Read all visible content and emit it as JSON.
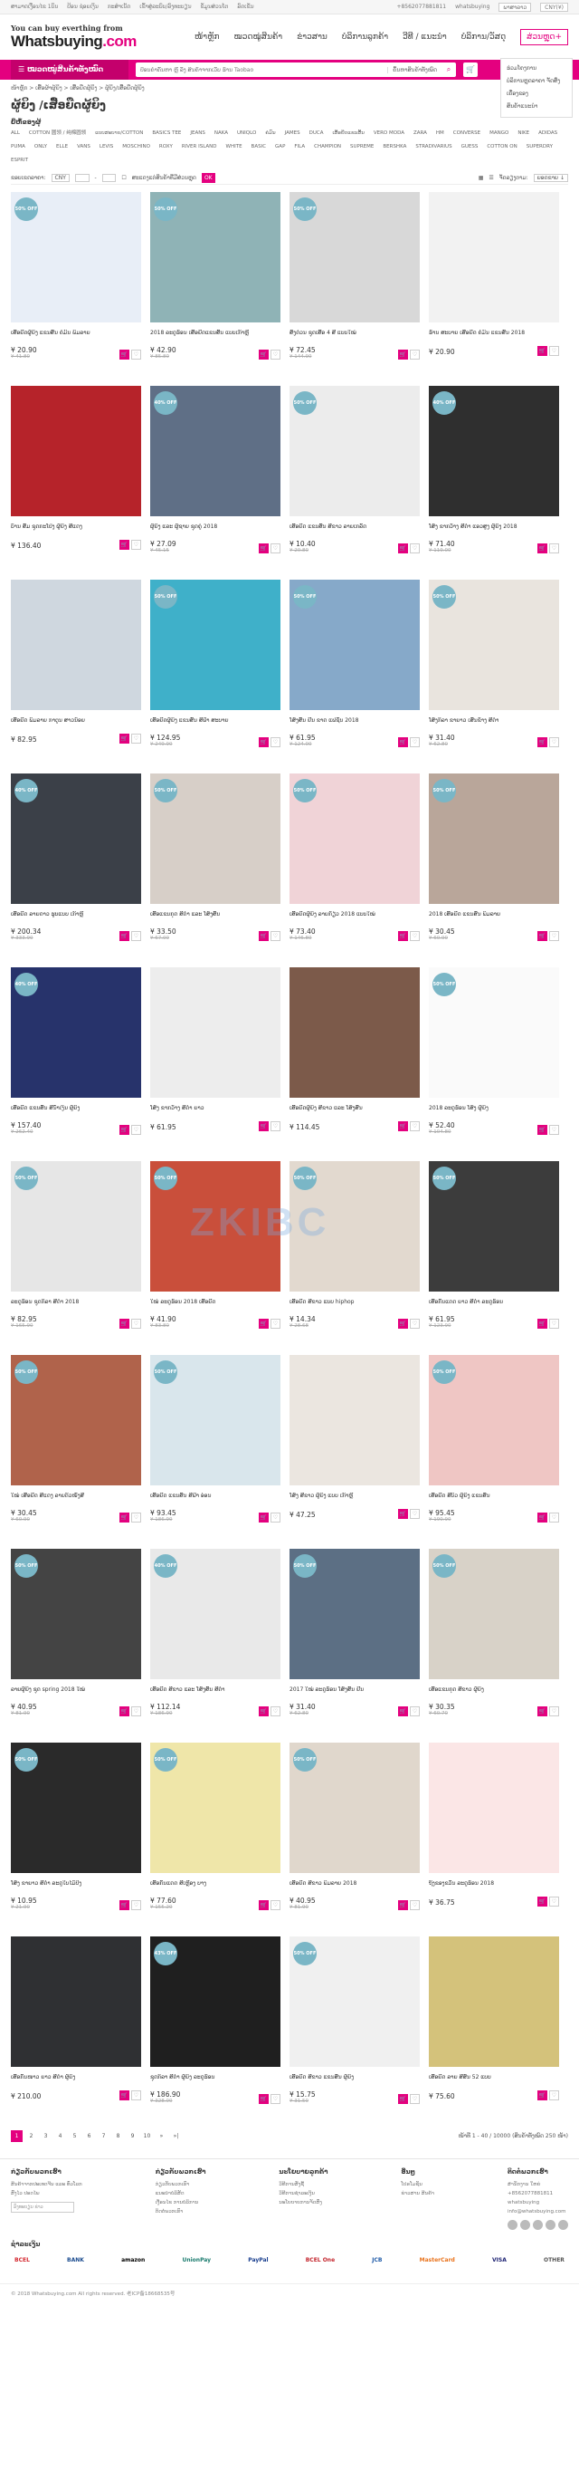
{
  "topbar": {
    "left": [
      "ສາມາດເງື່ອນໄຂ 1ບິນ",
      "ປ້ອນ ຊ່ອຍເງິນ",
      "ກະສຳເນັດ",
      "ເຂົ້າສູ່ລະບົບ/ລົງທະບຽນ",
      "ຂໍ້ມູນສ່ວນໂຕ",
      "ລົດເຂັນ"
    ],
    "phone": "+8562077881811",
    "wechat": "whatsbuying",
    "lang": "ພາສາລາວ",
    "currency": "CNY(¥)"
  },
  "header": {
    "tagline": "You can buy everthing from",
    "brand": "Whatsbuying",
    "brand_sub": ".com",
    "nav": [
      "ໜ້າຫຼັກ",
      "ໝວດໝູ່ສິນຄ້າ",
      "ຂ່າວສານ",
      "ບໍລິການລູກຄ້າ",
      "ວີທີ / ແນະນຳ",
      "ບໍລິການ/ວັສດຸ",
      "ສ່ວນຫຼຸດ+"
    ]
  },
  "catbar": {
    "label": "ໝວດໝູ່ສິນຄ້າທັງໝົດ",
    "search_placeholder": "ປ້ອນຄໍາຄົ້ນຫາ ຫຼື ລິ້ງ ສິນຄ້າຈາກເວັບ ຮ້ານ Taobao",
    "scope": "ຄົ້ນຫາສິນຄ້າທັງໝົດ"
  },
  "dropdown": [
    "ຮ່ວມໂຄງການ",
    "ບໍລິການຫຼຸດລາຄາ ຈັດສົ່ງເຄື່ອງຂອງ",
    "ສິນຄ້າແນະນໍາ"
  ],
  "breadcrumb": "ໜ້າຫຼັກ > ເສື້ອຜ້າຜູ້ຍິງ > ເສື້ອຍືດຜູ້ຍິງ > ຜູ້ຍິງ/ເສື້ອຍືດຜູ້ຍິງ",
  "title": "ຜູ້ຍິງ /ເສື້ອຍືດຜູ້ຍິງ",
  "filter_label": "ຍີ່ຫໍ້ຂອງຜູ້",
  "filters": [
    "ALL",
    "COTTON 圆领 / 纯棉圆领",
    "ແບບສະບາຍ/COTTON",
    "BASICS TEE",
    "JEANS",
    "NAKA",
    "UNIQLO",
    "ຄໍມົນ",
    "JAMES",
    "DUCA",
    "ເສື້ອຍືດແຂນສັ້ນ",
    "VERO MODA",
    "ZARA",
    "HM",
    "CONVERSE",
    "MANGO",
    "NIKE",
    "ADIDAS",
    "PUMA",
    "ONLY",
    "ELLE",
    "VANS",
    "LEVIS",
    "MOSCHINO",
    "ROXY",
    "RIVER ISLAND",
    "WHITE",
    "BASIC",
    "GAP",
    "FILA",
    "CHAMPION",
    "SUPREME",
    "BERSHKA",
    "STRADIVARIUS",
    "GUESS",
    "COTTON ON",
    "SUPERDRY",
    "ESPRIT"
  ],
  "sort": {
    "label": "ຂອບເຂດລາຄາ:",
    "currency": "CNY",
    "to": "-",
    "checkbox": "ສະແດງແຕ່ສິນຄ້າທີ່ມີສ່ວນຫຼຸດ",
    "go": "OK",
    "view": "ຈັດລຽງຕາມ:",
    "sort_sel": "ຍອດຂາຍ ↓"
  },
  "products": [
    {
      "t": "ເສື້ອຍືດຜູ້ຍິງ ແຂນສັ້ນ ຄໍມົນ ພິມລາຍ",
      "p": "¥ 20.90",
      "o": "¥ 41.80",
      "badge": "50% OFF",
      "c": "#e8eef7"
    },
    {
      "t": "2018 ລະດູຮ້ອນ ເສື້ອຍືດແຂນສັ້ນ ແບບເກົາຫຼີ",
      "p": "¥ 42.90",
      "o": "¥ 85.80",
      "badge": "50% OFF",
      "c": "#8fb3b6"
    },
    {
      "t": "ສົ່ງດ່ວນ ຊຸດເສື້ອ 4 ສີ ແບບໃໝ່",
      "p": "¥ 72.45",
      "o": "¥ 144.90",
      "badge": "50% OFF",
      "c": "#d8d8d8"
    },
    {
      "t": "ຮ້ານ ສະບາຍ ເສື້ອຍືດ ຄໍມົນ ແຂນສັ້ນ 2018",
      "p": "¥ 20.90",
      "o": "",
      "badge": "",
      "c": "#f2f2f2"
    },
    {
      "t": "ບ້ານ ສົ້ມ ຊຸດກະໂປ່ງ ຜູ້ຍິງ ສີແດງ",
      "p": "¥ 136.40",
      "o": "",
      "badge": "",
      "c": "#b6232a"
    },
    {
      "t": "ຜູ້ຍິງ ແລະ ຜູ້ຊາຍ ຊຸດຄູ່ 2018",
      "p": "¥ 27.09",
      "o": "¥ 45.15",
      "badge": "40% OFF",
      "c": "#5f6f86"
    },
    {
      "t": "ເສື້ອຍືດ ແຂນສັ້ນ ສີຂາວ ລາຍເກລັດ",
      "p": "¥ 10.40",
      "o": "¥ 20.80",
      "badge": "50% OFF",
      "c": "#ececec"
    },
    {
      "t": "ໂສ້ງ ຂາກວ້າງ ສີດຳ ແອວສູງ ຜູ້ຍິງ 2018",
      "p": "¥ 71.40",
      "o": "¥ 119.00",
      "badge": "40% OFF",
      "c": "#2f2f2f"
    },
    {
      "t": "ເສື້ອຍືດ ພິມລາຍ ກາຕູນ ສາວນ້ອຍ",
      "p": "¥ 82.95",
      "o": "",
      "badge": "",
      "c": "#cfd7df"
    },
    {
      "t": "ເສື້ອຍືດຜູ້ຍິງ ແຂນສັ້ນ ສີຟ້າ ສະບາຍ",
      "p": "¥ 124.95",
      "o": "¥ 249.90",
      "badge": "50% OFF",
      "c": "#3fb0c9"
    },
    {
      "t": "ໂສ້ງສັ້ນ ຢີນ ຂາດ ແຟຊັນ 2018",
      "p": "¥ 61.95",
      "o": "¥ 124.00",
      "badge": "50% OFF",
      "c": "#86a9c9"
    },
    {
      "t": "ໂສ້ງກິລາ ຂາຍາວ ເສັ້ນຂ້າງ ສີດຳ",
      "p": "¥ 31.40",
      "o": "¥ 62.80",
      "badge": "50% OFF",
      "c": "#e9e4de"
    },
    {
      "t": "ເສື້ອຍືດ ລາຍດາວ ຮູບແບບ ເກົາຫຼີ",
      "p": "¥ 200.34",
      "o": "¥ 333.90",
      "badge": "40% OFF",
      "c": "#3b4048"
    },
    {
      "t": "ເສື້ອແຂນກຸດ ສີດຳ ແລະ ໂສ້ງສັ້ນ",
      "p": "¥ 33.50",
      "o": "¥ 67.00",
      "badge": "50% OFF",
      "c": "#d7cfc8"
    },
    {
      "t": "ເສື້ອຍືດຜູ້ຍິງ ລາຍກ້ຽວ 2018 ແບບໃໝ່",
      "p": "¥ 73.40",
      "o": "¥ 146.80",
      "badge": "50% OFF",
      "c": "#f0d3d7"
    },
    {
      "t": "2018 ເສື້ອຍືດ ແຂນສັ້ນ ພິມລາຍ",
      "p": "¥ 30.45",
      "o": "¥ 60.90",
      "badge": "50% OFF",
      "c": "#b9a69a"
    },
    {
      "t": "ເສື້ອຍືດ ແຂນສັ້ນ ສີນ້ຳເງິນ ຜູ້ຍິງ",
      "p": "¥ 157.40",
      "o": "¥ 262.40",
      "badge": "40% OFF",
      "c": "#27336b"
    },
    {
      "t": "ໂສ້ງ ຂາກວ້າງ ສີດຳ ຍາວ",
      "p": "¥ 61.95",
      "o": "",
      "badge": "",
      "c": "#ededed"
    },
    {
      "t": "ເສື້ອຍືດຜູ້ຍິງ ສີຂາວ ແລະ ໂສ້ງສັ້ນ",
      "p": "¥ 114.45",
      "o": "",
      "badge": "",
      "c": "#7c5a4a"
    },
    {
      "t": "2018 ລະດູຮ້ອນ ໂສ້ງ ຜູ້ຍິງ",
      "p": "¥ 52.40",
      "o": "¥ 104.80",
      "badge": "50% OFF",
      "c": "#fafafa"
    },
    {
      "t": "ລະດູຮ້ອນ ຊຸດກິລາ ສີດຳ 2018",
      "p": "¥ 82.95",
      "o": "¥ 165.90",
      "badge": "50% OFF",
      "c": "#e6e6e6"
    },
    {
      "t": "ໃໝ່ ລະດູຮ້ອນ 2018 ເສື້ອຍືດ",
      "p": "¥ 41.90",
      "o": "¥ 83.80",
      "badge": "50% OFF",
      "c": "#c94f3b"
    },
    {
      "t": "ເສື້ອຍືດ ສີຂາວ ແບບ hiphop",
      "p": "¥ 14.34",
      "o": "¥ 28.68",
      "badge": "50% OFF",
      "c": "#e2d9cf"
    },
    {
      "t": "ເສື້ອກັນແດດ ຍາວ ສີດຳ ລະດູຮ້ອນ",
      "p": "¥ 61.95",
      "o": "¥ 123.90",
      "badge": "50% OFF",
      "c": "#3c3c3c"
    },
    {
      "t": "ໃໝ່ ເສື້ອຍືດ ສີແດງ ລາຍຕົວໜັງສື",
      "p": "¥ 30.45",
      "o": "¥ 60.90",
      "badge": "50% OFF",
      "c": "#b0634b"
    },
    {
      "t": "ເສື້ອຍືດ ແຂນສັ້ນ ສີຟ້າ ອ່ອນ",
      "p": "¥ 93.45",
      "o": "¥ 186.90",
      "badge": "50% OFF",
      "c": "#d9e6ec"
    },
    {
      "t": "ໂສ້ງ ສີຂາວ ຜູ້ຍິງ ແບບ ເກົາຫຼີ",
      "p": "¥ 47.25",
      "o": "",
      "badge": "",
      "c": "#ebe6e0"
    },
    {
      "t": "ເສື້ອຍືດ ສີບົວ ຜູ້ຍິງ ແຂນສັ້ນ",
      "p": "¥ 95.45",
      "o": "¥ 190.90",
      "badge": "50% OFF",
      "c": "#efc6c4"
    },
    {
      "t": "ລາຍຜູ້ຍິງ ຊຸດ spring 2018 ໃໝ່",
      "p": "¥ 40.95",
      "o": "¥ 81.90",
      "badge": "50% OFF",
      "c": "#444444"
    },
    {
      "t": "ເສື້ອຍືດ ສີຂາວ ແລະ ໂສ້ງສັ້ນ ສີດຳ",
      "p": "¥ 112.14",
      "o": "¥ 186.90",
      "badge": "40% OFF",
      "c": "#e9e9e9"
    },
    {
      "t": "2017 ໃໝ່ ລະດູຮ້ອນ ໂສ້ງສັ້ນ ຢີນ",
      "p": "¥ 31.40",
      "o": "¥ 62.80",
      "badge": "50% OFF",
      "c": "#5c6f84"
    },
    {
      "t": "ເສື້ອແຂນກຸດ ສີຂາວ ຜູ້ຍິງ",
      "p": "¥ 30.35",
      "o": "¥ 60.70",
      "badge": "50% OFF",
      "c": "#d8d2c8"
    },
    {
      "t": "ໂສ້ງ ຂາຍາວ ສີດຳ ລະດູໃບໄມ້ປົ່ງ",
      "p": "¥ 10.95",
      "o": "¥ 21.90",
      "badge": "50% OFF",
      "c": "#2a2a2a"
    },
    {
      "t": "ເສື້ອກັນແດດ ສີເຫຼືອງ ບາງ",
      "p": "¥ 77.60",
      "o": "¥ 155.20",
      "badge": "50% OFF",
      "c": "#efe6a9"
    },
    {
      "t": "ເສື້ອຍືດ ສີຂາວ ພິມລາຍ 2018",
      "p": "¥ 40.95",
      "o": "¥ 81.90",
      "badge": "50% OFF",
      "c": "#e0d7cc"
    },
    {
      "t": "ຖົງຂອງຂວັນ ລະດູຮ້ອນ 2018",
      "p": "¥ 36.75",
      "o": "",
      "badge": "",
      "c": "#fbe6e6"
    },
    {
      "t": "ເສື້ອກັນໜາວ ຍາວ ສີດຳ ຜູ້ຍິງ",
      "p": "¥ 210.00",
      "o": "",
      "badge": "",
      "c": "#2f3033"
    },
    {
      "t": "ຊຸດກິລາ ສີດຳ ຜູ້ຍິງ ລະດູຮ້ອນ",
      "p": "¥ 186.90",
      "o": "¥ 328.00",
      "badge": "43% OFF",
      "c": "#1f1f1f"
    },
    {
      "t": "ເສື້ອຍືດ ສີຂາວ ແຂນສັ້ນ ຜູ້ຍິງ",
      "p": "¥ 15.75",
      "o": "¥ 31.50",
      "badge": "50% OFF",
      "c": "#f0f0f0"
    },
    {
      "t": "ເສື້ອຍືດ ລາຍ ສີສັນ 52 ແບບ",
      "p": "¥ 75.60",
      "o": "",
      "badge": "",
      "c": "#d4c27b"
    }
  ],
  "pager": {
    "pages": [
      "1",
      "2",
      "3",
      "4",
      "5",
      "6",
      "7",
      "8",
      "9",
      "10",
      "»",
      "»|"
    ],
    "current": "1",
    "info": "ໜ້າທີ 1 - 40 / 10000 (ສິນຄ້າທັງໝົດ 250 ໜ້າ)"
  },
  "footer": {
    "about": {
      "title": "ກ່ຽວກັບພວກເຮົາ",
      "lines": [
        "ສິນຄ້າຈາກປະເທດຈີນ ແລະ ທົ່ວໂລກ",
        "ສົ່ງໄວ ປອດໄພ"
      ],
      "news": "ລົງທະບຽນ ຂ່າວ"
    },
    "c2": {
      "title": "ກ່ຽວກັບພວກເຮົາ",
      "lines": [
        "ກ່ຽວກັບພວກເຮົາ",
        "ແນະນຳບໍລິສັດ",
        "ເງື່ອນໄຂ ການບໍລິການ",
        "ຕິດຕໍ່ພວກເຮົາ"
      ]
    },
    "c3": {
      "title": "ນະໂຍບາຍລູກຄ້າ",
      "lines": [
        "ວິທີການສັ່ງຊື້",
        "ວິທີການຊຳລະເງິນ",
        "ນະໂຍບາຍການຈັດສົ່ງ"
      ]
    },
    "c4": {
      "title": "ອື່ນໆ",
      "lines": [
        "ໂປຣໂມຊັ່ນ",
        "ຂ່າວສານ ສິນຄ້າ"
      ]
    },
    "c5": {
      "title": "ຕິດຕໍ່ພວກເຮົາ",
      "lines": [
        "ສຳນັກງານ ໃຫຍ່",
        "+8562077881811",
        "whatsbuying",
        "info@whatsbuying.com"
      ]
    },
    "pay_title": "ຊຳລະເງິນ",
    "pay": [
      "BCEL",
      "BANK",
      "amazon",
      "UnionPay",
      "PayPal",
      "BCEL One",
      "JCB",
      "MasterCard",
      "VISA",
      "OTHER"
    ],
    "copyright": "© 2018 Whatsbuying.com All rights reserved. 老ICP备18668535号"
  },
  "watermark": "ZKIBC"
}
